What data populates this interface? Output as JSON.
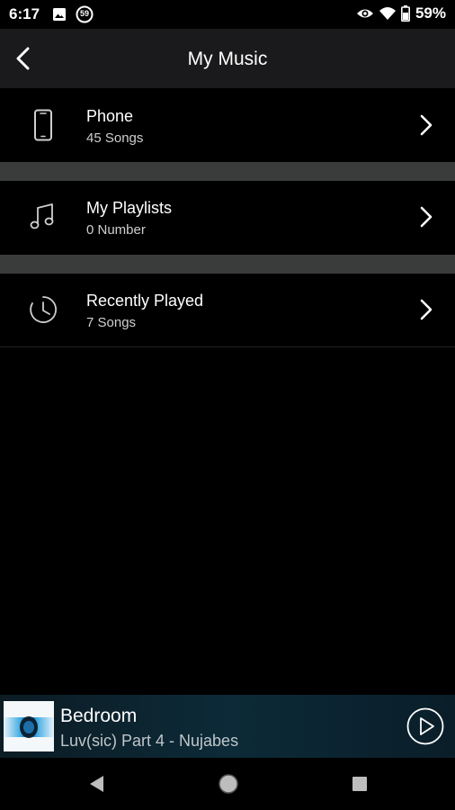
{
  "status_bar": {
    "time": "6:17",
    "battery_percent": "59%",
    "notification_badge": "59"
  },
  "header": {
    "title": "My Music"
  },
  "menu": {
    "items": [
      {
        "title": "Phone",
        "subtitle": "45  Songs",
        "icon": "phone-icon"
      },
      {
        "title": "My Playlists",
        "subtitle": "0 Number",
        "icon": "music-note-icon"
      },
      {
        "title": "Recently Played",
        "subtitle": "7  Songs",
        "icon": "clock-icon"
      }
    ]
  },
  "now_playing": {
    "title": "Bedroom",
    "subtitle": "Luv(sic) Part 4 - Nujabes"
  },
  "colors": {
    "background": "#000000",
    "app_bar": "#1a1a1c",
    "separator": "#3a3c3c",
    "now_playing_bg": "#0c2a38"
  }
}
